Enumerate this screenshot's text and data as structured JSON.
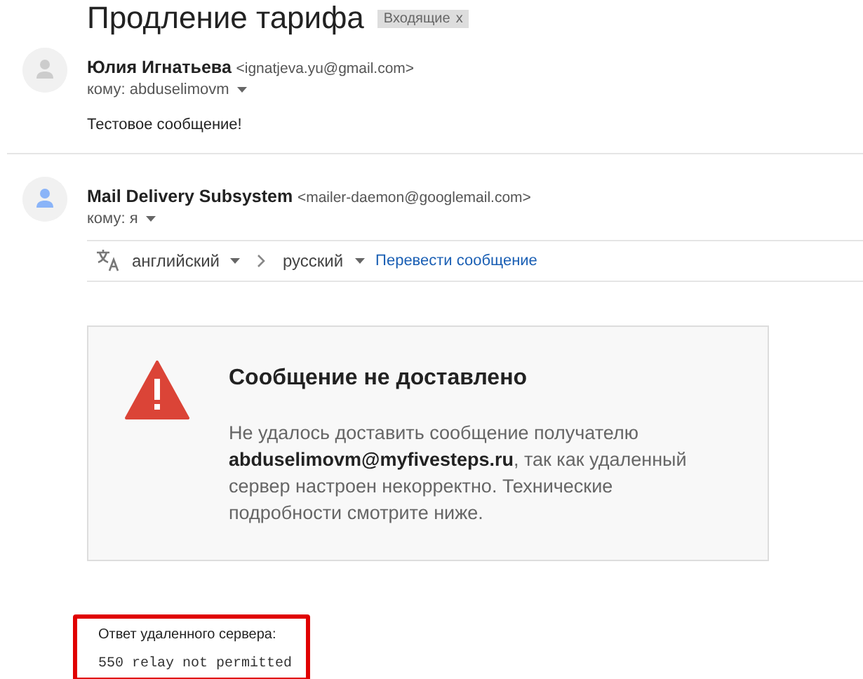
{
  "thread": {
    "subject": "Продление тарифа",
    "label": "Входящие",
    "label_close": "x"
  },
  "messages": [
    {
      "sender": "Юлия Игнатьева",
      "email": "<ignatjeva.yu@gmail.com>",
      "to": "кому: abduselimovm",
      "color": "#cccccc",
      "body": "Тестовое сообщение!"
    },
    {
      "sender": "Mail Delivery Subsystem",
      "email": "<mailer-daemon@googlemail.com>",
      "to": "кому: я",
      "color": "#8ab4f8"
    }
  ],
  "translate_bar": {
    "from": "английский",
    "to": "русский",
    "action": "Перевести сообщение"
  },
  "bounce_card": {
    "heading": "Сообщение не доставлено",
    "text": "Не удалось доставить сообщение получателю **abduselimovm@myfivesteps.ru**, так как удаленный сервер настроен некорректно. Технические подробности смотрите ниже."
  },
  "server_response": {
    "title": "Ответ удаленного сервера:",
    "code": "550 relay not permitted"
  }
}
